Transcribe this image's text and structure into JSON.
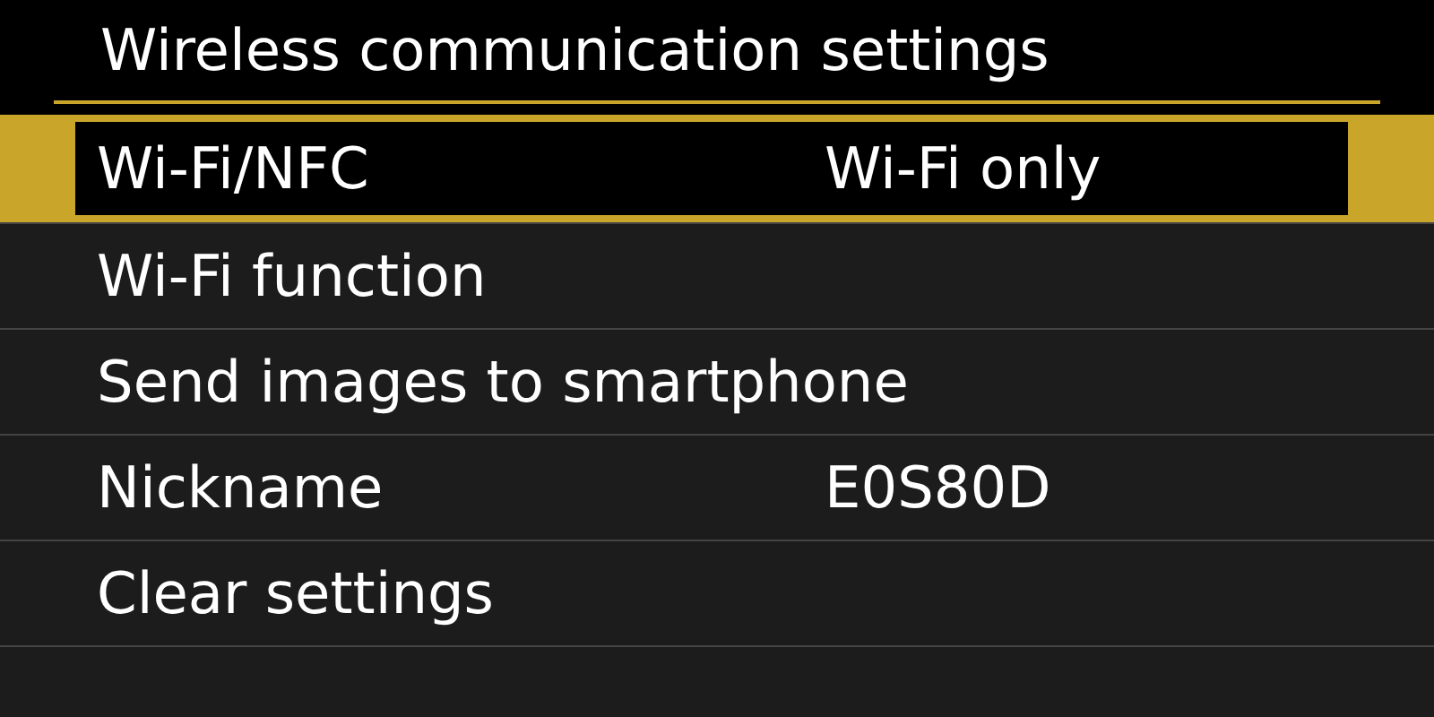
{
  "title": "Wireless communication settings",
  "items": [
    {
      "label": "Wi-Fi/NFC",
      "value": "Wi-Fi only",
      "selected": true
    },
    {
      "label": "Wi-Fi function",
      "selected": false
    },
    {
      "label": "Send images to smartphone",
      "selected": false
    },
    {
      "label": "Nickname",
      "value": "E0S80D",
      "selected": false
    },
    {
      "label": "Clear settings",
      "selected": false
    }
  ]
}
